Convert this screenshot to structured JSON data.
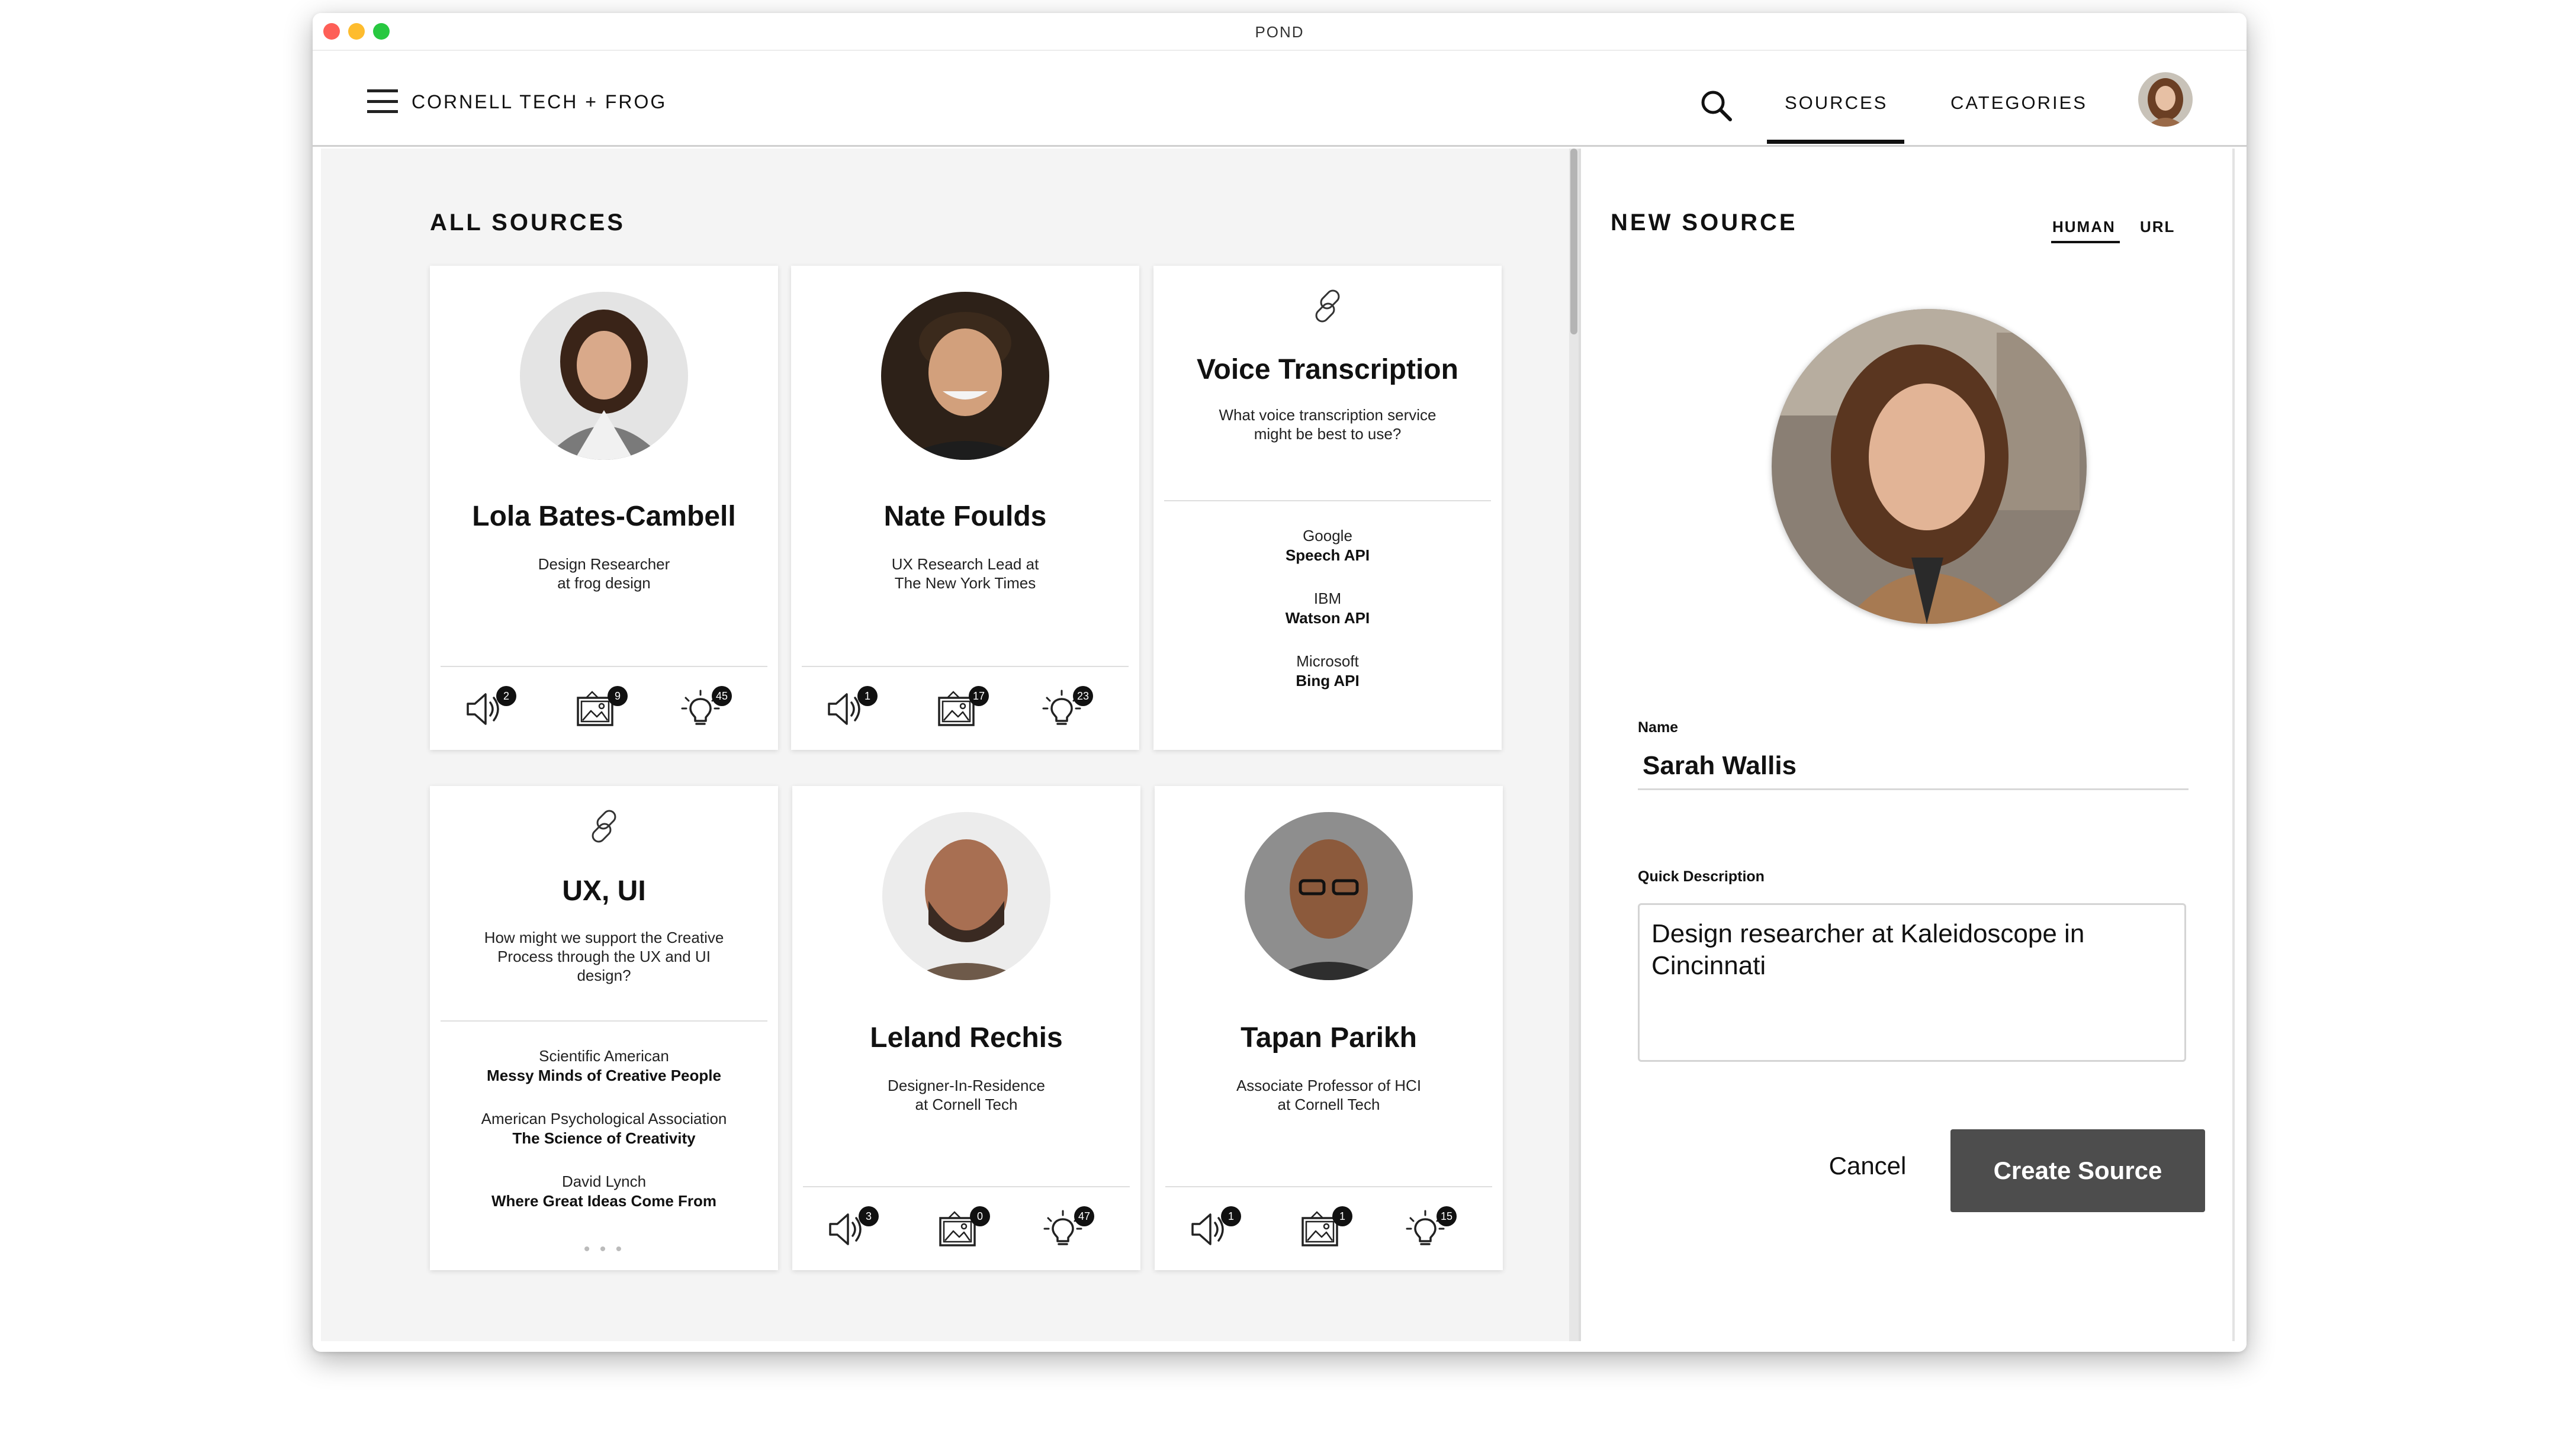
{
  "window": {
    "title": "POND"
  },
  "nav": {
    "brand": "CORNELL TECH + FROG",
    "items": [
      {
        "label": "SOURCES",
        "active": true
      },
      {
        "label": "CATEGORIES",
        "active": false
      }
    ]
  },
  "all_sources": {
    "title": "ALL SOURCES",
    "people": [
      {
        "name": "Lola Bates-Cambell",
        "description_line1": "Design Researcher",
        "description_line2": "at frog design",
        "stats": {
          "audio": "2",
          "images": "9",
          "ideas": "45"
        }
      },
      {
        "name": "Nate Foulds",
        "description_line1": "UX Research Lead at",
        "description_line2": "The New York Times",
        "stats": {
          "audio": "1",
          "images": "17",
          "ideas": "23"
        }
      },
      {
        "name": "Leland Rechis",
        "description_line1": "Designer-In-Residence",
        "description_line2": "at Cornell Tech",
        "stats": {
          "audio": "3",
          "images": "0",
          "ideas": "47"
        }
      },
      {
        "name": "Tapan Parikh",
        "description_line1": "Associate Professor of HCI",
        "description_line2": "at Cornell Tech",
        "stats": {
          "audio": "1",
          "images": "1",
          "ideas": "15"
        }
      }
    ],
    "topics": [
      {
        "title": "Voice Transcription",
        "question_line1": "What voice transcription service",
        "question_line2": "might be best to use?",
        "question_line3": "",
        "refs": [
          {
            "source": "Google",
            "title": "Speech API"
          },
          {
            "source": "IBM",
            "title": "Watson API"
          },
          {
            "source": "Microsoft",
            "title": "Bing API"
          }
        ]
      },
      {
        "title": "UX, UI",
        "question_line1": "How might we support the Creative",
        "question_line2": "Process through the UX and UI",
        "question_line3": "design?",
        "refs": [
          {
            "source": "Scientific American",
            "title": "Messy Minds of Creative People"
          },
          {
            "source": "American Psychological Association",
            "title": "The Science of Creativity"
          },
          {
            "source": "David Lynch",
            "title": "Where Great Ideas Come From"
          }
        ],
        "more": "• • •"
      }
    ]
  },
  "new_source": {
    "title": "NEW SOURCE",
    "tabs": [
      {
        "label": "HUMAN",
        "active": true
      },
      {
        "label": "URL",
        "active": false
      }
    ],
    "name_label": "Name",
    "name_value": "Sarah Wallis",
    "desc_label": "Quick Description",
    "desc_value": "Design researcher at Kaleidoscope in Cincinnati",
    "cancel_label": "Cancel",
    "create_label": "Create Source"
  },
  "icons": {
    "menu": "hamburger-menu-icon",
    "search": "search-icon",
    "link": "link-icon",
    "audio": "speaker-icon",
    "images": "image-icon",
    "ideas": "lightbulb-icon"
  },
  "colors": {
    "panel_bg": "#f4f4f4",
    "badge_bg": "#111111",
    "primary_button": "#4d4d4d",
    "traffic_red": "#fe5f57",
    "traffic_yellow": "#febc2e",
    "traffic_green": "#28c840"
  }
}
